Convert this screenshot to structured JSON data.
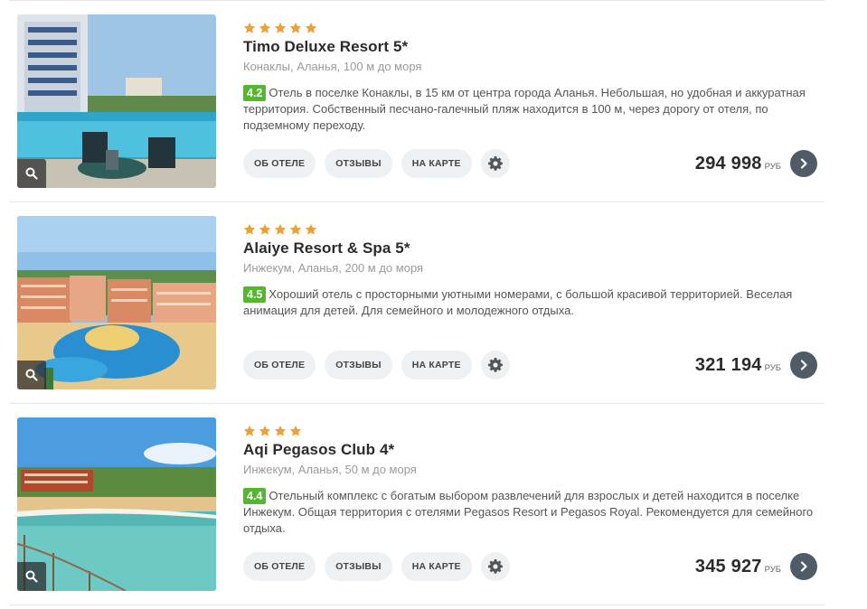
{
  "hotels": [
    {
      "stars": 5,
      "name": "Timo Deluxe Resort 5*",
      "location": "Конаклы, Аланья, 100 м до моря",
      "rating": "4.2",
      "description": "Отель в поселке Конаклы, в 15 км от центра города Аланья. Небольшая, но удобная и аккуратная территория. Собственный песчано-галечный пляж находится в 100 м, через дорогу от отеля, по подземному переходу.",
      "price": "294 998",
      "currency": "РУБ"
    },
    {
      "stars": 5,
      "name": "Alaiye Resort & Spa 5*",
      "location": "Инжекум, Аланья, 200 м до моря",
      "rating": "4.5",
      "description": "Хороший отель с просторными уютными номерами, с большой красивой территорией. Веселая анимация для детей. Для семейного и молодежного отдыха.",
      "price": "321 194",
      "currency": "РУБ"
    },
    {
      "stars": 4,
      "name": "Aqi Pegasos Club 4*",
      "location": "Инжекум, Аланья, 50 м до моря",
      "rating": "4.4",
      "description": "Отельный комплекс с богатым выбором развлечений для взрослых и детей находится в поселке Инжекум. Общая территория с отелями Pegasos Resort и Pegasos Royal. Рекомендуется для семейного отдыха.",
      "price": "345 927",
      "currency": "РУБ"
    }
  ],
  "buttons": {
    "about": "ОБ ОТЕЛЕ",
    "reviews": "ОТЗЫВЫ",
    "map": "НА КАРТЕ"
  },
  "colors": {
    "star": "#f0a030",
    "rating_badge": "#53b82c",
    "go_button": "#4f5b66"
  },
  "icons": {
    "photo_zoom": "search-icon",
    "options": "gear-icon",
    "go": "chevron-right-icon"
  }
}
